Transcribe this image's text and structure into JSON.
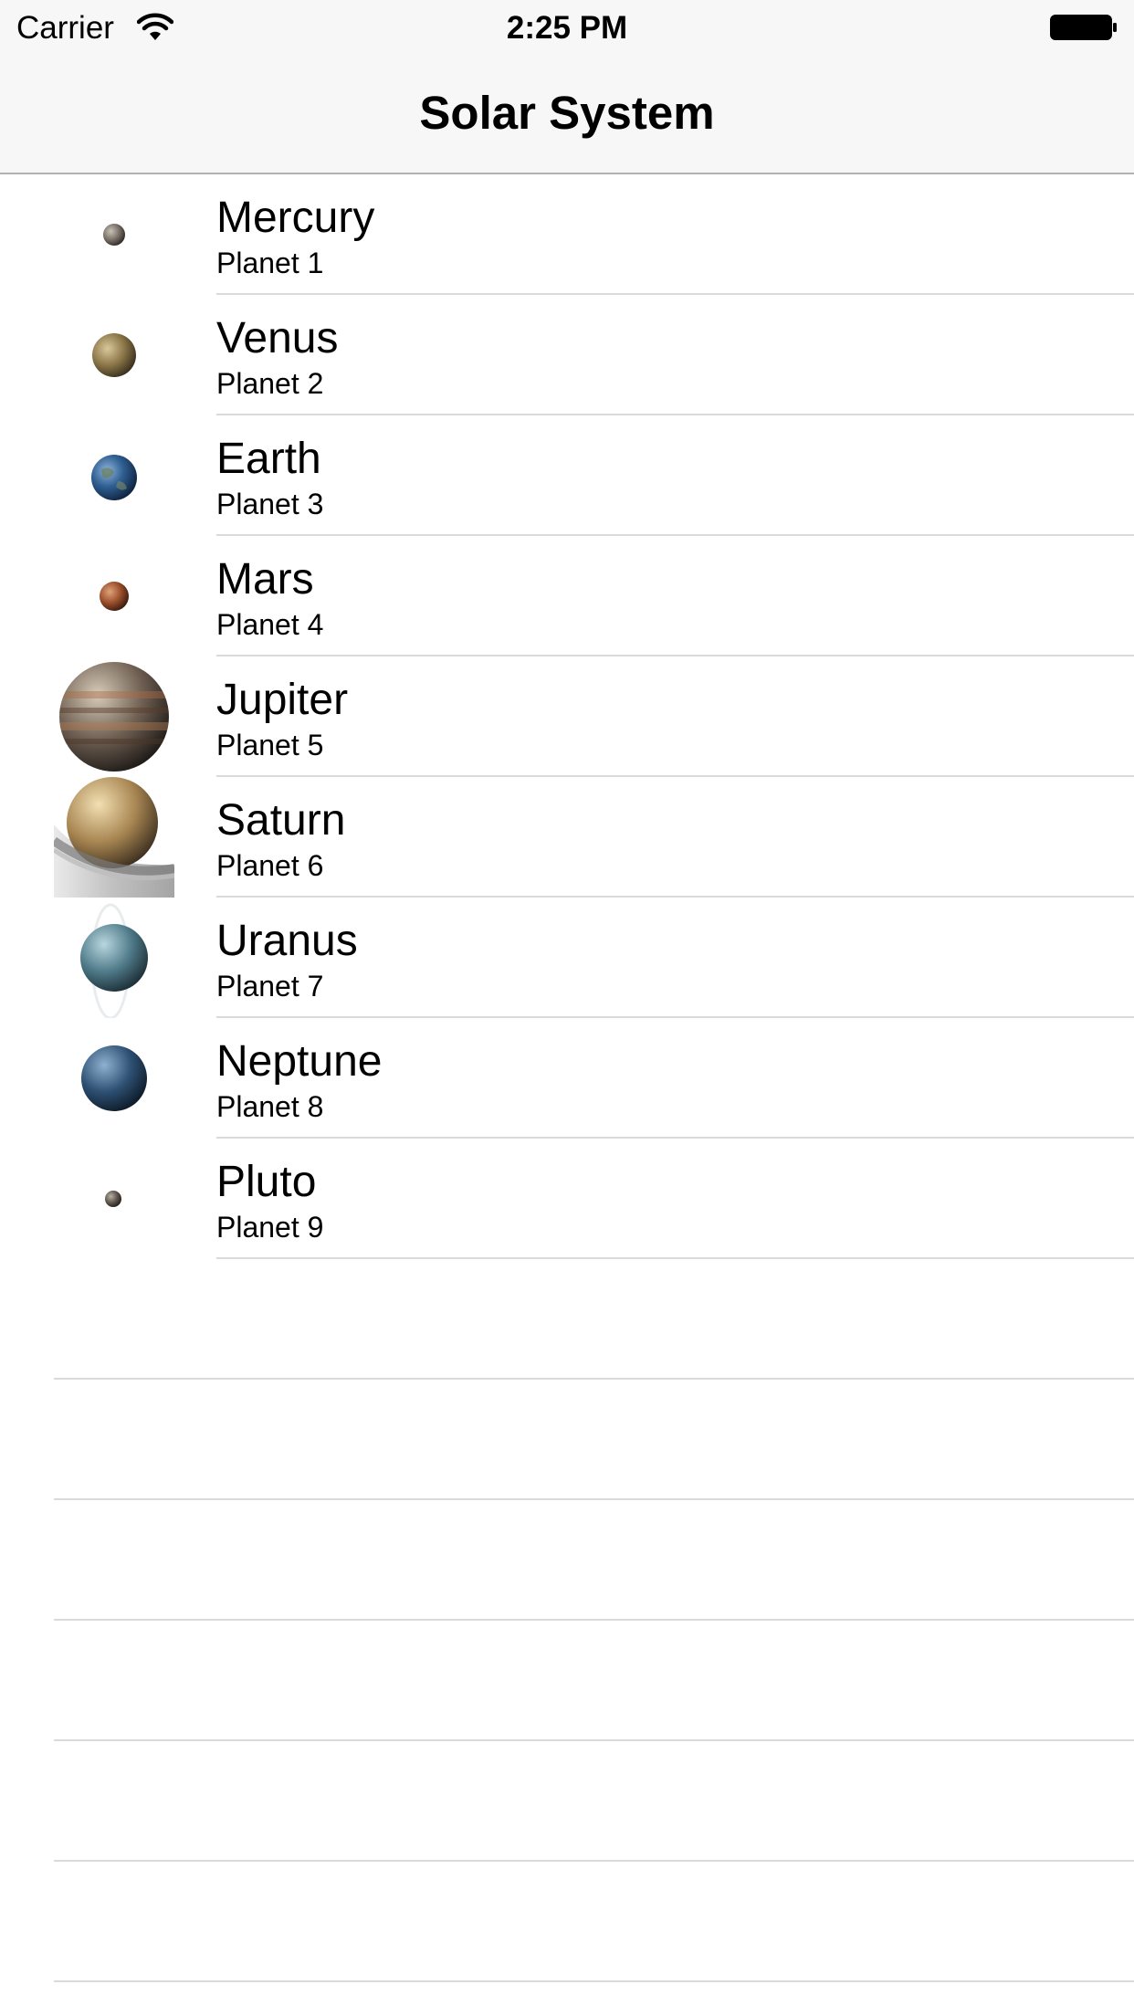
{
  "status_bar": {
    "carrier": "Carrier",
    "time": "2:25 PM"
  },
  "nav": {
    "title": "Solar System"
  },
  "planets": [
    {
      "name": "Mercury",
      "subtitle": "Planet 1",
      "icon": "mercury-icon"
    },
    {
      "name": "Venus",
      "subtitle": "Planet 2",
      "icon": "venus-icon"
    },
    {
      "name": "Earth",
      "subtitle": "Planet 3",
      "icon": "earth-icon"
    },
    {
      "name": "Mars",
      "subtitle": "Planet 4",
      "icon": "mars-icon"
    },
    {
      "name": "Jupiter",
      "subtitle": "Planet 5",
      "icon": "jupiter-icon"
    },
    {
      "name": "Saturn",
      "subtitle": "Planet 6",
      "icon": "saturn-icon"
    },
    {
      "name": "Uranus",
      "subtitle": "Planet 7",
      "icon": "uranus-icon"
    },
    {
      "name": "Neptune",
      "subtitle": "Planet 8",
      "icon": "neptune-icon"
    },
    {
      "name": "Pluto",
      "subtitle": "Planet 9",
      "icon": "pluto-icon"
    }
  ],
  "colors": {
    "nav_background": "#f7f7f7",
    "separator": "#d9d9de",
    "text": "#000000"
  }
}
